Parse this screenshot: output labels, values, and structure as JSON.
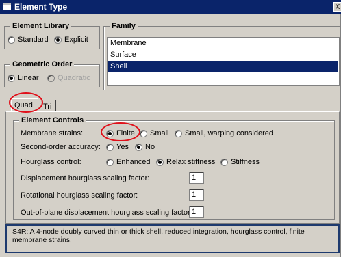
{
  "window": {
    "title": "Element Type",
    "close_glyph": "X"
  },
  "element_library": {
    "legend": "Element Library",
    "options": [
      "Standard",
      "Explicit"
    ],
    "selected": "Explicit"
  },
  "family": {
    "legend": "Family",
    "items": [
      "Membrane",
      "Surface",
      "Shell"
    ],
    "selected": "Shell"
  },
  "geometric_order": {
    "legend": "Geometric Order",
    "options": [
      "Linear",
      "Quadratic"
    ],
    "selected": "Linear"
  },
  "tabs": [
    {
      "label": "Quad",
      "active": true
    },
    {
      "label": "Tri",
      "active": false
    }
  ],
  "controls": {
    "legend": "Element Controls",
    "membrane_strains": {
      "label": "Membrane strains:",
      "options": [
        "Finite",
        "Small",
        "Small, warping considered"
      ],
      "selected": "Finite"
    },
    "second_order": {
      "label": "Second-order accuracy:",
      "options": [
        "Yes",
        "No"
      ],
      "selected": "No"
    },
    "hourglass": {
      "label": "Hourglass control:",
      "options": [
        "Enhanced",
        "Relax stiffness",
        "Stiffness"
      ],
      "selected": "Relax stiffness"
    },
    "displacement_factor": {
      "label": "Displacement hourglass scaling factor:",
      "value": "1"
    },
    "rotational_factor": {
      "label": "Rotational hourglass scaling factor:",
      "value": "1"
    },
    "outofplane_factor": {
      "label": "Out-of-plane displacement hourglass scaling factor:",
      "value": "1"
    }
  },
  "description": {
    "line1": "S4R:  A 4-node doubly curved thin or thick shell, reduced integration, hourglass control, finite",
    "line2": "membrane strains."
  },
  "colors": {
    "titlebar": "#0a246a",
    "dialog": "#d4d0c8",
    "annotation": "#e0101a"
  }
}
